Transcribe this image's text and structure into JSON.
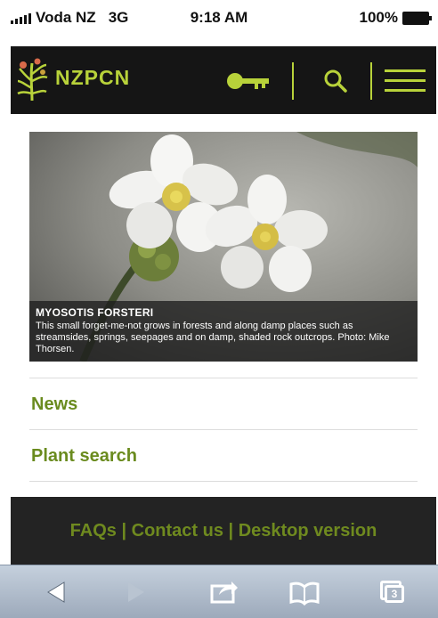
{
  "status_bar": {
    "carrier": "Voda NZ",
    "network": "3G",
    "time": "9:18 AM",
    "battery": "100%"
  },
  "header": {
    "brand": "NZPCN",
    "icons": [
      "fern-logo-icon",
      "key-icon",
      "search-icon",
      "menu-icon"
    ],
    "accent_color": "#b8d23a"
  },
  "hero": {
    "title": "MYOSOTIS FORSTERI",
    "caption": "This small forget-me-not grows in forests and along damp places such as streamsides, springs, seepages and on damp, shaded rock outcrops. Photo: Mike Thorsen."
  },
  "links": {
    "news": "News",
    "plant_search": "Plant search"
  },
  "footer": {
    "faqs": "FAQs",
    "contact": "Contact us",
    "desktop": "Desktop version",
    "separator": " | "
  },
  "browser_toolbar": {
    "tab_count": "3",
    "icons": [
      "back-icon",
      "forward-icon",
      "share-icon",
      "bookmarks-icon",
      "tabs-icon"
    ]
  }
}
